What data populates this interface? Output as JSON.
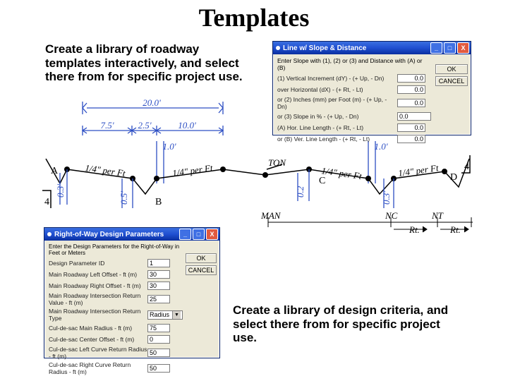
{
  "title": "Templates",
  "text1": "Create a library of roadway templates interactively, and select there from for specific project use.",
  "text2": "Create a library of design criteria, and select there from for specific project use.",
  "diagram": {
    "dim_20": "20.0'",
    "dim_75": "7.5'",
    "dim_25": "2.5'",
    "dim_10": "10.0'",
    "dim_1a": "1.0'",
    "dim_1b": "1.0'",
    "slope1": "1/4\" per Ft",
    "slope2": "1/4\" per Ft",
    "slope3": "1/4\" per Ft",
    "slope4": "1/4\" per Ft",
    "ton": "TON",
    "v03a": "0.3'",
    "v05": "0.5'",
    "v02": "0.2",
    "v03b": "0.3'",
    "frac4a": "1\n4",
    "frac4b": "1\n4",
    "labelA": "A",
    "labelB": "B",
    "labelC": "C",
    "labelD": "D",
    "man": "MAN",
    "nc": "NC",
    "nt": "NT",
    "rt1": "Rt.",
    "rt2": "Rt."
  },
  "dlg1": {
    "title": "Line w/ Slope & Distance",
    "intro": "Enter Slope with (1), (2) or (3) and Distance with (A) or (B)",
    "r1": "(1) Vertical Increment (dY) - (+ Up, - Dn)",
    "r2": "over Horizontal (dX) - (+ Rt, - Lt)",
    "r3": "or (2) Inches (mm) per Foot (m) - (+ Up, - Dn)",
    "r4": "or (3) Slope in % - (+ Up, - Dn)",
    "r5": "(A) Hor. Line Length - (+ Rt, - Lt)",
    "r6": "or (B) Ver. Line Length - (+ Rt, - Lt)",
    "v1": "0.0",
    "v2": "0.0",
    "v3": "0.0",
    "v4": "0.0",
    "v5": "0.0",
    "v6": "0.0",
    "ok": "OK",
    "cancel": "CANCEL"
  },
  "dlg2": {
    "title": "Right-of-Way Design Parameters",
    "intro": "Enter the Design Parameters for the Right-of-Way in Feet or Meters",
    "r0": "Design Parameter ID",
    "r1": "Main Roadway Left Offset - ft (m)",
    "r2": "Main Roadway Right Offset - ft (m)",
    "r3": "Main Roadway Intersection Return Value - ft (m)",
    "r4": "Main Roadway Intersection Return Type",
    "r5": "Cul-de-sac Main Radius - ft (m)",
    "r6": "Cul-de-sac Center Offset - ft (m)",
    "r7": "Cul-de-sac Left Curve Return Radius - ft (m)",
    "r8": "Cul-de-sac Right Curve Return Radius - ft (m)",
    "v0": "1",
    "v1": "30",
    "v2": "30",
    "v3": "25",
    "v4": "Radius",
    "v5": "75",
    "v6": "0",
    "v7": "50",
    "v8": "50",
    "ok": "OK",
    "cancel": "CANCEL"
  }
}
